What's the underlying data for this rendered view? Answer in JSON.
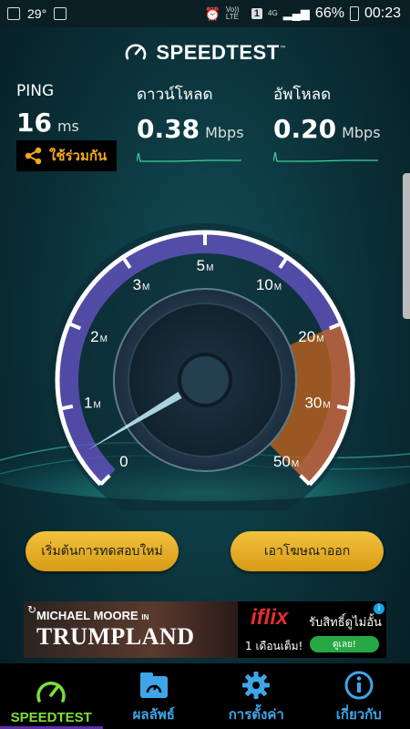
{
  "status_bar": {
    "temperature": "29°",
    "volte": "Vo)) LTE",
    "sim": "1",
    "network": "4G",
    "battery": "66%",
    "time": "00:23"
  },
  "header": {
    "title": "SPEEDTEST",
    "tm": "™"
  },
  "ping": {
    "label": "PING",
    "value": "16",
    "unit": "ms"
  },
  "download": {
    "label": "ดาวน์โหลด",
    "value": "0.38",
    "unit": "Mbps"
  },
  "upload": {
    "label": "อัพโหลด",
    "value": "0.20",
    "unit": "Mbps"
  },
  "share": {
    "label": "ใช้ร่วมกัน"
  },
  "gauge": {
    "ticks": [
      {
        "label": "0",
        "suffix": ""
      },
      {
        "label": "1",
        "suffix": "M"
      },
      {
        "label": "2",
        "suffix": "M"
      },
      {
        "label": "3",
        "suffix": "M"
      },
      {
        "label": "5",
        "suffix": "M"
      },
      {
        "label": "10",
        "suffix": "M"
      },
      {
        "label": "20",
        "suffix": "M"
      },
      {
        "label": "30",
        "suffix": "M"
      },
      {
        "label": "50",
        "suffix": "M"
      }
    ],
    "colors": {
      "arc": "#ffffff",
      "glow": "#8a62ff",
      "upload_sector": "#c8651c",
      "needle": "#c7f1ff"
    }
  },
  "buttons": {
    "restart": "เริ่มต้นการทดสอบใหม่",
    "remove_ads": "เอาโฆษณาออก"
  },
  "ad": {
    "movie_line1": "MICHAEL MOORE",
    "movie_in": "IN",
    "movie_title": "TRUMPLAND",
    "brand": "iflix",
    "offer": "รับสิทธิ์ดูไม่อั้น",
    "month": "1 เดือนเต็ม!",
    "cta": "ดูเลย!"
  },
  "nav": {
    "items": [
      {
        "label": "SPEEDTEST",
        "icon": "gauge-icon"
      },
      {
        "label": "ผลลัพธ์",
        "icon": "results-icon"
      },
      {
        "label": "การตั้งค่า",
        "icon": "gear-icon"
      },
      {
        "label": "เกี่ยวกับ",
        "icon": "info-icon"
      }
    ]
  }
}
